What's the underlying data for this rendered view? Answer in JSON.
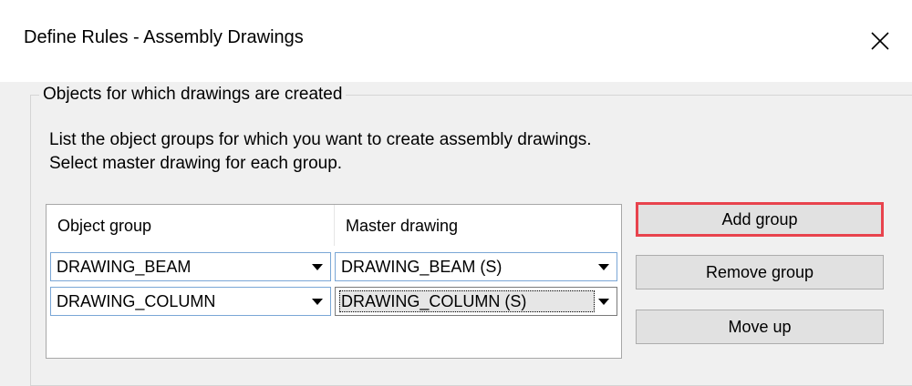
{
  "window": {
    "title": "Define Rules - Assembly Drawings"
  },
  "icons": {
    "close": "close-icon"
  },
  "groupbox": {
    "legend": "Objects for which drawings are created",
    "desc_line1": "List the object groups for which you want to create assembly drawings.",
    "desc_line2": "Select master drawing for each group."
  },
  "grid": {
    "headers": [
      "Object group",
      "Master drawing"
    ],
    "rows": [
      {
        "object_group": "DRAWING_BEAM",
        "master_drawing": "DRAWING_BEAM (S)"
      },
      {
        "object_group": "DRAWING_COLUMN",
        "master_drawing": "DRAWING_COLUMN (S)"
      }
    ]
  },
  "buttons": {
    "add_group": "Add group",
    "remove_group": "Remove group",
    "move_up": "Move up"
  },
  "colors": {
    "highlight": "#e8434d",
    "cell_border": "#7aa7d6"
  }
}
